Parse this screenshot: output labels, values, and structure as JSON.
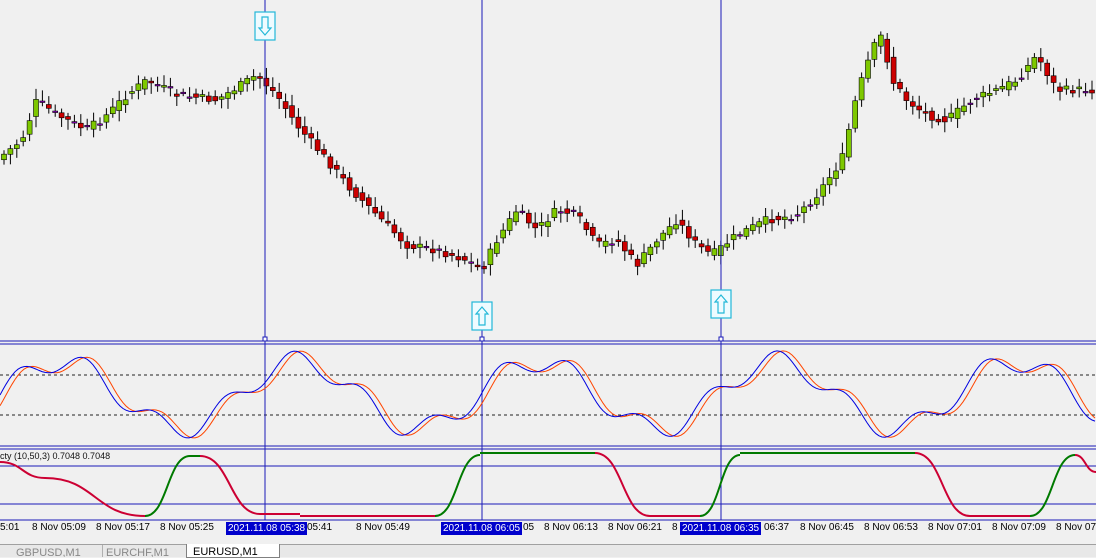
{
  "window": {
    "indicator_label": "cty (10,50,3) 0.7048 0.7048"
  },
  "time_axis": {
    "labels": [
      "5:01",
      "8 Nov 05:09",
      "8 Nov 05:17",
      "8 Nov 05:25",
      "05:41",
      "8 Nov 05:49",
      "05",
      "8 Nov 06:13",
      "8 Nov 06:21",
      "8",
      "06:37",
      "8 Nov 06:45",
      "8 Nov 06:53",
      "8 Nov 07:01",
      "8 Nov 07:09",
      "8 Nov 07"
    ],
    "highlights": [
      "2021.11.08 05:38",
      "2021.11.08 06:05",
      "2021.11.08 06:35"
    ]
  },
  "tabs": [
    {
      "label": "GBPUSD,M1",
      "active": false
    },
    {
      "label": "EURCHF,M1",
      "active": false
    },
    {
      "label": "EURUSD,M1",
      "active": true
    }
  ],
  "colors": {
    "bull": "#7ec800",
    "bear": "#cc0000",
    "doji": "#9900cc",
    "vline": "#1a1ab8",
    "arrow": "#22b8d8",
    "stoch_main": "#0000e0",
    "stoch_signal": "#ff4500",
    "ind_green": "#007a00",
    "ind_red": "#cc0033"
  },
  "markers": [
    {
      "type": "sell-arrow",
      "time": "2021.11.08 05:38"
    },
    {
      "type": "buy-arrow",
      "time": "2021.11.08 06:05"
    },
    {
      "type": "buy-arrow",
      "time": "2021.11.08 06:35"
    }
  ]
}
